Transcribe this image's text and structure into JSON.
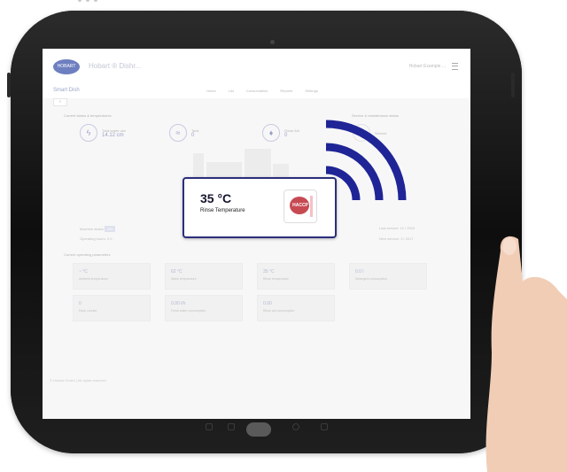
{
  "app": {
    "brand_title": "Hobart ® Dishr...",
    "app_name": "Smart Dish",
    "user_area": "Hobart Example ...",
    "logo_text": "HOBART"
  },
  "nav": [
    "Home",
    "List",
    "Consumables",
    "Reports",
    "Settings"
  ],
  "sections": {
    "left_title": "Current status & temperatures",
    "right_title": "Service & maintenance status"
  },
  "metrics": [
    {
      "icon": "gauge-icon",
      "label": "Total water use",
      "value": "14.12 cm"
    },
    {
      "icon": "water-icon",
      "label": "Tank",
      "value": "0"
    },
    {
      "icon": "drop-icon",
      "label": "Rinse Aid",
      "value": "0"
    },
    {
      "icon": "wrench-icon",
      "label": "Service",
      "value": ""
    }
  ],
  "status_rows": {
    "left_1": "Machine status",
    "left_chip": "ON",
    "left_2": "Operating hours: 2 h",
    "right_1": "Last service: 12 / 2016",
    "right_2": "Next service: 3 / 2017"
  },
  "params": {
    "title": "Current operating parameters",
    "cards": [
      {
        "value": "~ °C",
        "label": "Ambient temperature"
      },
      {
        "value": "62 °C",
        "label": "Wash temperature"
      },
      {
        "value": "35 °C",
        "label": "Rinse temperature"
      },
      {
        "value": "0.0 l",
        "label": "Detergent consumption"
      },
      {
        "value": "0",
        "label": "Rack counter"
      },
      {
        "value": "0.00 l/h",
        "label": "Fresh water consumption"
      },
      {
        "value": "0.00",
        "label": "Rinse aid consumption"
      }
    ]
  },
  "footer": "© Hobart GmbH | All rights reserved",
  "popup": {
    "temperature": "35 °C",
    "label": "Rinse Temperature",
    "badge_text": "HACCP"
  },
  "colors": {
    "accent": "#2b2e7a",
    "badge": "#c74a53",
    "wifi": "#1f2596"
  }
}
